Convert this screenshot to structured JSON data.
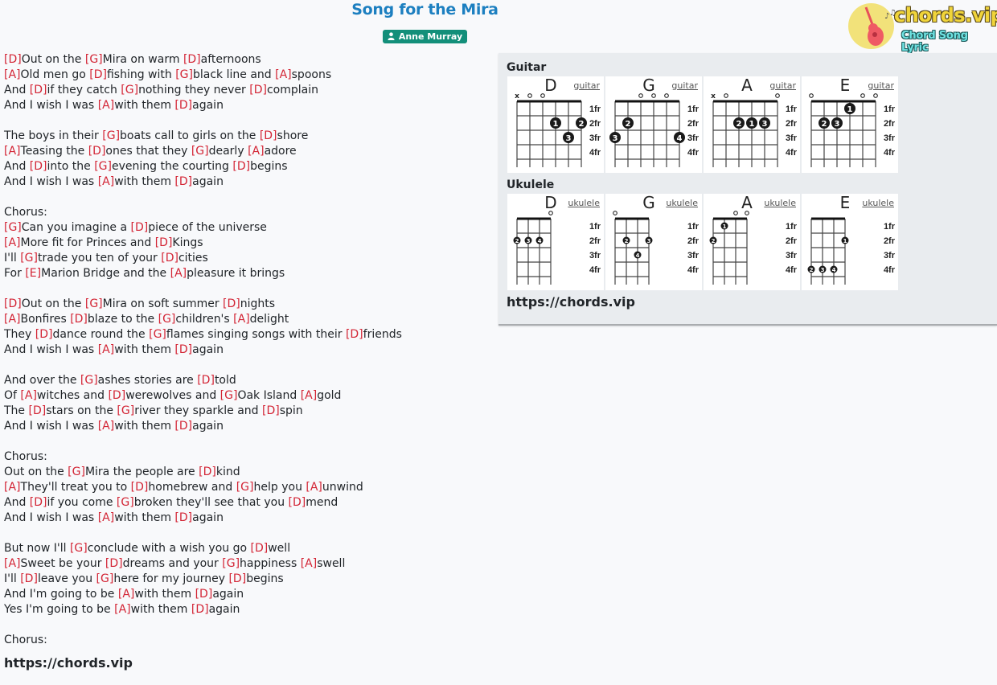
{
  "song": {
    "title": "Song for the Mira",
    "artist": "Anne Murray",
    "artist_icon": "user-icon"
  },
  "logo": {
    "brand": "chords.vip",
    "tagline": "Chord Song Lyric",
    "icon": "guitar-icon"
  },
  "lyrics": [
    [
      {
        "c": "D"
      },
      {
        "t": "Out on the "
      },
      {
        "c": "G"
      },
      {
        "t": "Mira on warm "
      },
      {
        "c": "D"
      },
      {
        "t": "afternoons"
      }
    ],
    [
      {
        "c": "A"
      },
      {
        "t": "Old men go "
      },
      {
        "c": "D"
      },
      {
        "t": "fishing with "
      },
      {
        "c": "G"
      },
      {
        "t": "black line and "
      },
      {
        "c": "A"
      },
      {
        "t": "spoons"
      }
    ],
    [
      {
        "t": "And "
      },
      {
        "c": "D"
      },
      {
        "t": "if they catch "
      },
      {
        "c": "G"
      },
      {
        "t": "nothing they never "
      },
      {
        "c": "D"
      },
      {
        "t": "complain"
      }
    ],
    [
      {
        "t": "And I wish I was "
      },
      {
        "c": "A"
      },
      {
        "t": "with them "
      },
      {
        "c": "D"
      },
      {
        "t": "again"
      }
    ],
    [],
    [
      {
        "t": "The boys in their "
      },
      {
        "c": "G"
      },
      {
        "t": "boats call to girls on the "
      },
      {
        "c": "D"
      },
      {
        "t": "shore"
      }
    ],
    [
      {
        "c": "A"
      },
      {
        "t": "Teasing the "
      },
      {
        "c": "D"
      },
      {
        "t": "ones that they "
      },
      {
        "c": "G"
      },
      {
        "t": "dearly "
      },
      {
        "c": "A"
      },
      {
        "t": "adore"
      }
    ],
    [
      {
        "t": "And "
      },
      {
        "c": "D"
      },
      {
        "t": "into the "
      },
      {
        "c": "G"
      },
      {
        "t": "evening the courting "
      },
      {
        "c": "D"
      },
      {
        "t": "begins"
      }
    ],
    [
      {
        "t": "And I wish I was "
      },
      {
        "c": "A"
      },
      {
        "t": "with them "
      },
      {
        "c": "D"
      },
      {
        "t": "again"
      }
    ],
    [],
    [
      {
        "t": "Chorus:"
      }
    ],
    [
      {
        "c": "G"
      },
      {
        "t": "Can you imagine a "
      },
      {
        "c": "D"
      },
      {
        "t": "piece of the universe"
      }
    ],
    [
      {
        "c": "A"
      },
      {
        "t": "More fit for Princes and "
      },
      {
        "c": "D"
      },
      {
        "t": "Kings"
      }
    ],
    [
      {
        "t": "I'll "
      },
      {
        "c": "G"
      },
      {
        "t": "trade you ten of your "
      },
      {
        "c": "D"
      },
      {
        "t": "cities"
      }
    ],
    [
      {
        "t": "For "
      },
      {
        "c": "E"
      },
      {
        "t": "Marion Bridge and the "
      },
      {
        "c": "A"
      },
      {
        "t": "pleasure it brings"
      }
    ],
    [],
    [
      {
        "c": "D"
      },
      {
        "t": "Out on the "
      },
      {
        "c": "G"
      },
      {
        "t": "Mira on soft summer "
      },
      {
        "c": "D"
      },
      {
        "t": "nights"
      }
    ],
    [
      {
        "c": "A"
      },
      {
        "t": "Bonfires "
      },
      {
        "c": "D"
      },
      {
        "t": "blaze to the "
      },
      {
        "c": "G"
      },
      {
        "t": "children's "
      },
      {
        "c": "A"
      },
      {
        "t": "delight"
      }
    ],
    [
      {
        "t": "They "
      },
      {
        "c": "D"
      },
      {
        "t": "dance round the "
      },
      {
        "c": "G"
      },
      {
        "t": "flames singing songs with their "
      },
      {
        "c": "D"
      },
      {
        "t": "friends"
      }
    ],
    [
      {
        "t": "And I wish I was "
      },
      {
        "c": "A"
      },
      {
        "t": "with them "
      },
      {
        "c": "D"
      },
      {
        "t": "again"
      }
    ],
    [],
    [
      {
        "t": "And over the "
      },
      {
        "c": "G"
      },
      {
        "t": "ashes stories are "
      },
      {
        "c": "D"
      },
      {
        "t": "told"
      }
    ],
    [
      {
        "t": "Of "
      },
      {
        "c": "A"
      },
      {
        "t": "witches and "
      },
      {
        "c": "D"
      },
      {
        "t": "werewolves and "
      },
      {
        "c": "G"
      },
      {
        "t": "Oak Island "
      },
      {
        "c": "A"
      },
      {
        "t": "gold"
      }
    ],
    [
      {
        "t": "The "
      },
      {
        "c": "D"
      },
      {
        "t": "stars on the "
      },
      {
        "c": "G"
      },
      {
        "t": "river they sparkle and "
      },
      {
        "c": "D"
      },
      {
        "t": "spin"
      }
    ],
    [
      {
        "t": "And I wish I was "
      },
      {
        "c": "A"
      },
      {
        "t": "with them "
      },
      {
        "c": "D"
      },
      {
        "t": "again"
      }
    ],
    [],
    [
      {
        "t": "Chorus:"
      }
    ],
    [
      {
        "t": "Out on the "
      },
      {
        "c": "G"
      },
      {
        "t": "Mira the people are "
      },
      {
        "c": "D"
      },
      {
        "t": "kind"
      }
    ],
    [
      {
        "c": "A"
      },
      {
        "t": "They'll treat you to "
      },
      {
        "c": "D"
      },
      {
        "t": "homebrew and "
      },
      {
        "c": "G"
      },
      {
        "t": "help you "
      },
      {
        "c": "A"
      },
      {
        "t": "unwind"
      }
    ],
    [
      {
        "t": "And "
      },
      {
        "c": "D"
      },
      {
        "t": "if you come "
      },
      {
        "c": "G"
      },
      {
        "t": "broken they'll see that you "
      },
      {
        "c": "D"
      },
      {
        "t": "mend"
      }
    ],
    [
      {
        "t": "And I wish I was "
      },
      {
        "c": "A"
      },
      {
        "t": "with them "
      },
      {
        "c": "D"
      },
      {
        "t": "again"
      }
    ],
    [],
    [
      {
        "t": "But now I'll "
      },
      {
        "c": "G"
      },
      {
        "t": "conclude with a wish you go "
      },
      {
        "c": "D"
      },
      {
        "t": "well"
      }
    ],
    [
      {
        "c": "A"
      },
      {
        "t": "Sweet be your "
      },
      {
        "c": "D"
      },
      {
        "t": "dreams and your "
      },
      {
        "c": "G"
      },
      {
        "t": "happiness "
      },
      {
        "c": "A"
      },
      {
        "t": "swell"
      }
    ],
    [
      {
        "t": "I'll "
      },
      {
        "c": "D"
      },
      {
        "t": "leave you "
      },
      {
        "c": "G"
      },
      {
        "t": "here for my journey "
      },
      {
        "c": "D"
      },
      {
        "t": "begins"
      }
    ],
    [
      {
        "t": "And I'm going to be "
      },
      {
        "c": "A"
      },
      {
        "t": "with them "
      },
      {
        "c": "D"
      },
      {
        "t": "again"
      }
    ],
    [
      {
        "t": "Yes I'm going to be "
      },
      {
        "c": "A"
      },
      {
        "t": "with them "
      },
      {
        "c": "D"
      },
      {
        "t": "again"
      }
    ],
    [],
    [
      {
        "t": "Chorus:"
      }
    ]
  ],
  "lyrics_footer_url": "https://chords.vip",
  "panel": {
    "guitar_label": "Guitar",
    "ukulele_label": "Ukulele",
    "url": "https://chords.vip",
    "fret_labels": [
      "1fr",
      "2fr",
      "3fr",
      "4fr"
    ],
    "guitar_chords": [
      {
        "name": "D",
        "link": "guitar",
        "open_muted": [
          "x",
          "o",
          "o",
          "",
          "",
          ""
        ],
        "fingers": [
          {
            "string": 4,
            "fret": 2,
            "finger": "1"
          },
          {
            "string": 6,
            "fret": 2,
            "finger": "2"
          },
          {
            "string": 5,
            "fret": 3,
            "finger": "3"
          }
        ]
      },
      {
        "name": "G",
        "link": "guitar",
        "open_muted": [
          "",
          "",
          "o",
          "o",
          "o",
          ""
        ],
        "fingers": [
          {
            "string": 2,
            "fret": 2,
            "finger": "2"
          },
          {
            "string": 1,
            "fret": 3,
            "finger": "3"
          },
          {
            "string": 6,
            "fret": 3,
            "finger": "4"
          }
        ]
      },
      {
        "name": "A",
        "link": "guitar",
        "open_muted": [
          "x",
          "o",
          "",
          "",
          "",
          "o"
        ],
        "fingers": [
          {
            "string": 3,
            "fret": 2,
            "finger": "2"
          },
          {
            "string": 4,
            "fret": 2,
            "finger": "1"
          },
          {
            "string": 5,
            "fret": 2,
            "finger": "3"
          }
        ]
      },
      {
        "name": "E",
        "link": "guitar",
        "open_muted": [
          "o",
          "",
          "",
          "",
          "o",
          "o"
        ],
        "fingers": [
          {
            "string": 4,
            "fret": 1,
            "finger": "1"
          },
          {
            "string": 2,
            "fret": 2,
            "finger": "2"
          },
          {
            "string": 3,
            "fret": 2,
            "finger": "3"
          }
        ]
      }
    ],
    "ukulele_chords": [
      {
        "name": "D",
        "link": "ukulele",
        "open_muted": [
          "",
          "",
          "",
          "o"
        ],
        "fingers": [
          {
            "string": 1,
            "fret": 2,
            "finger": "2"
          },
          {
            "string": 2,
            "fret": 2,
            "finger": "3"
          },
          {
            "string": 3,
            "fret": 2,
            "finger": "4"
          }
        ]
      },
      {
        "name": "G",
        "link": "ukulele",
        "open_muted": [
          "o",
          "",
          "",
          ""
        ],
        "fingers": [
          {
            "string": 2,
            "fret": 2,
            "finger": "2"
          },
          {
            "string": 4,
            "fret": 2,
            "finger": "3"
          },
          {
            "string": 3,
            "fret": 3,
            "finger": "4"
          }
        ]
      },
      {
        "name": "A",
        "link": "ukulele",
        "open_muted": [
          "",
          "",
          "o",
          "o"
        ],
        "fingers": [
          {
            "string": 2,
            "fret": 1,
            "finger": "1"
          },
          {
            "string": 1,
            "fret": 2,
            "finger": "2"
          }
        ]
      },
      {
        "name": "E",
        "link": "ukulele",
        "open_muted": [
          "",
          "",
          "",
          ""
        ],
        "fingers": [
          {
            "string": 4,
            "fret": 2,
            "finger": "1"
          },
          {
            "string": 1,
            "fret": 4,
            "finger": "2"
          },
          {
            "string": 2,
            "fret": 4,
            "finger": "3"
          },
          {
            "string": 3,
            "fret": 4,
            "finger": "4"
          }
        ]
      }
    ]
  }
}
